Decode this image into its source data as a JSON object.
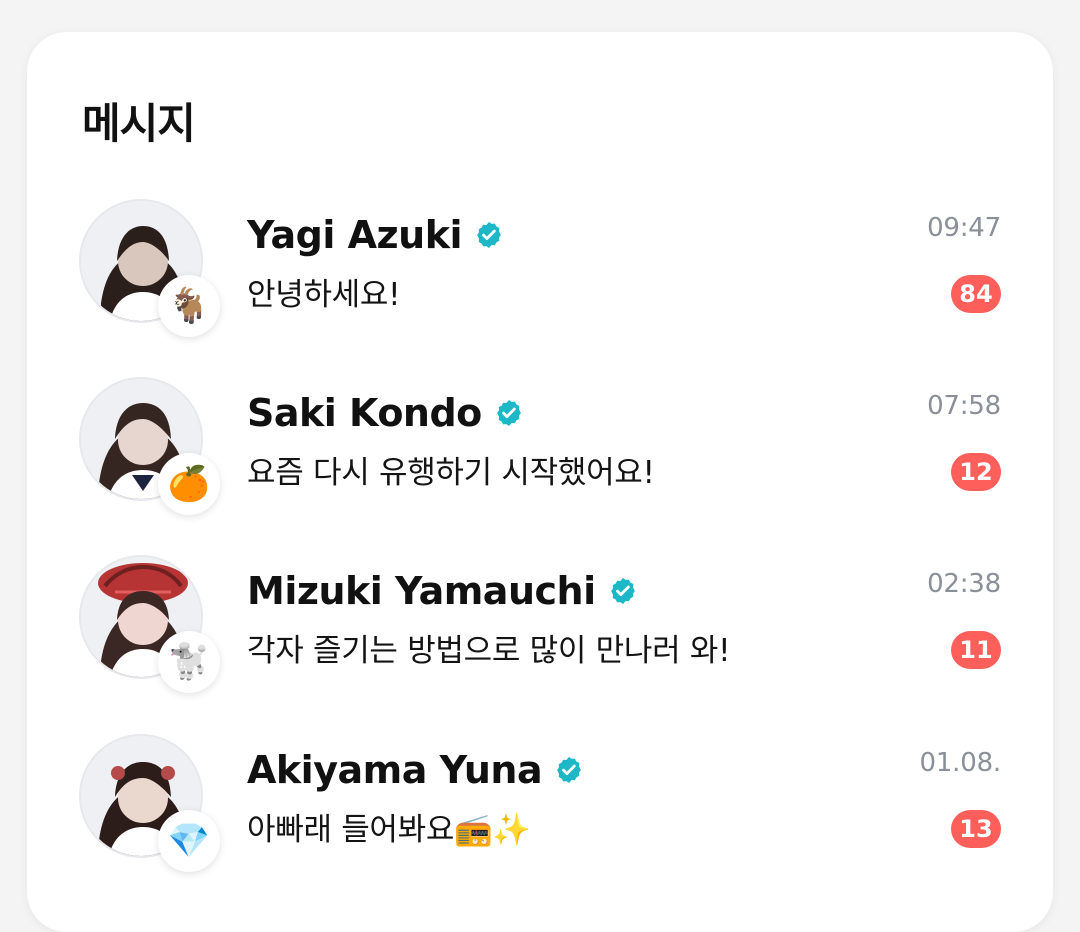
{
  "header": {
    "title": "메시지"
  },
  "chat_list": [
    {
      "name": "Yagi Azuki",
      "verified": true,
      "message": "안녕하세요!",
      "time": "09:47",
      "unread_count": "84",
      "emoji": "🐐",
      "avatar_color": "#d9c7bd",
      "hair_color": "#2b1f1c"
    },
    {
      "name": "Saki Kondo",
      "verified": true,
      "message": "요즘 다시 유행하기 시작했어요!",
      "time": "07:58",
      "unread_count": "12",
      "emoji": "🍊",
      "avatar_color": "#e7d6cf",
      "hair_color": "#362622"
    },
    {
      "name": "Mizuki Yamauchi",
      "verified": true,
      "message": "각자 즐기는 방법으로 많이 만나러 와!",
      "time": "02:38",
      "unread_count": "11",
      "emoji": "🐩",
      "avatar_color": "#f0d6d0",
      "hair_color": "#3b2723",
      "hat_color": "#b73434"
    },
    {
      "name": "Akiyama Yuna",
      "verified": true,
      "message": "아빠래 들어봐요📻✨",
      "time": "01.08.",
      "unread_count": "13",
      "emoji": "💎",
      "avatar_color": "#ead7cd",
      "hair_color": "#2c1d1a"
    }
  ],
  "colors": {
    "verified_badge": "#1db8c7",
    "unread_badge": "#ff5f5a"
  }
}
